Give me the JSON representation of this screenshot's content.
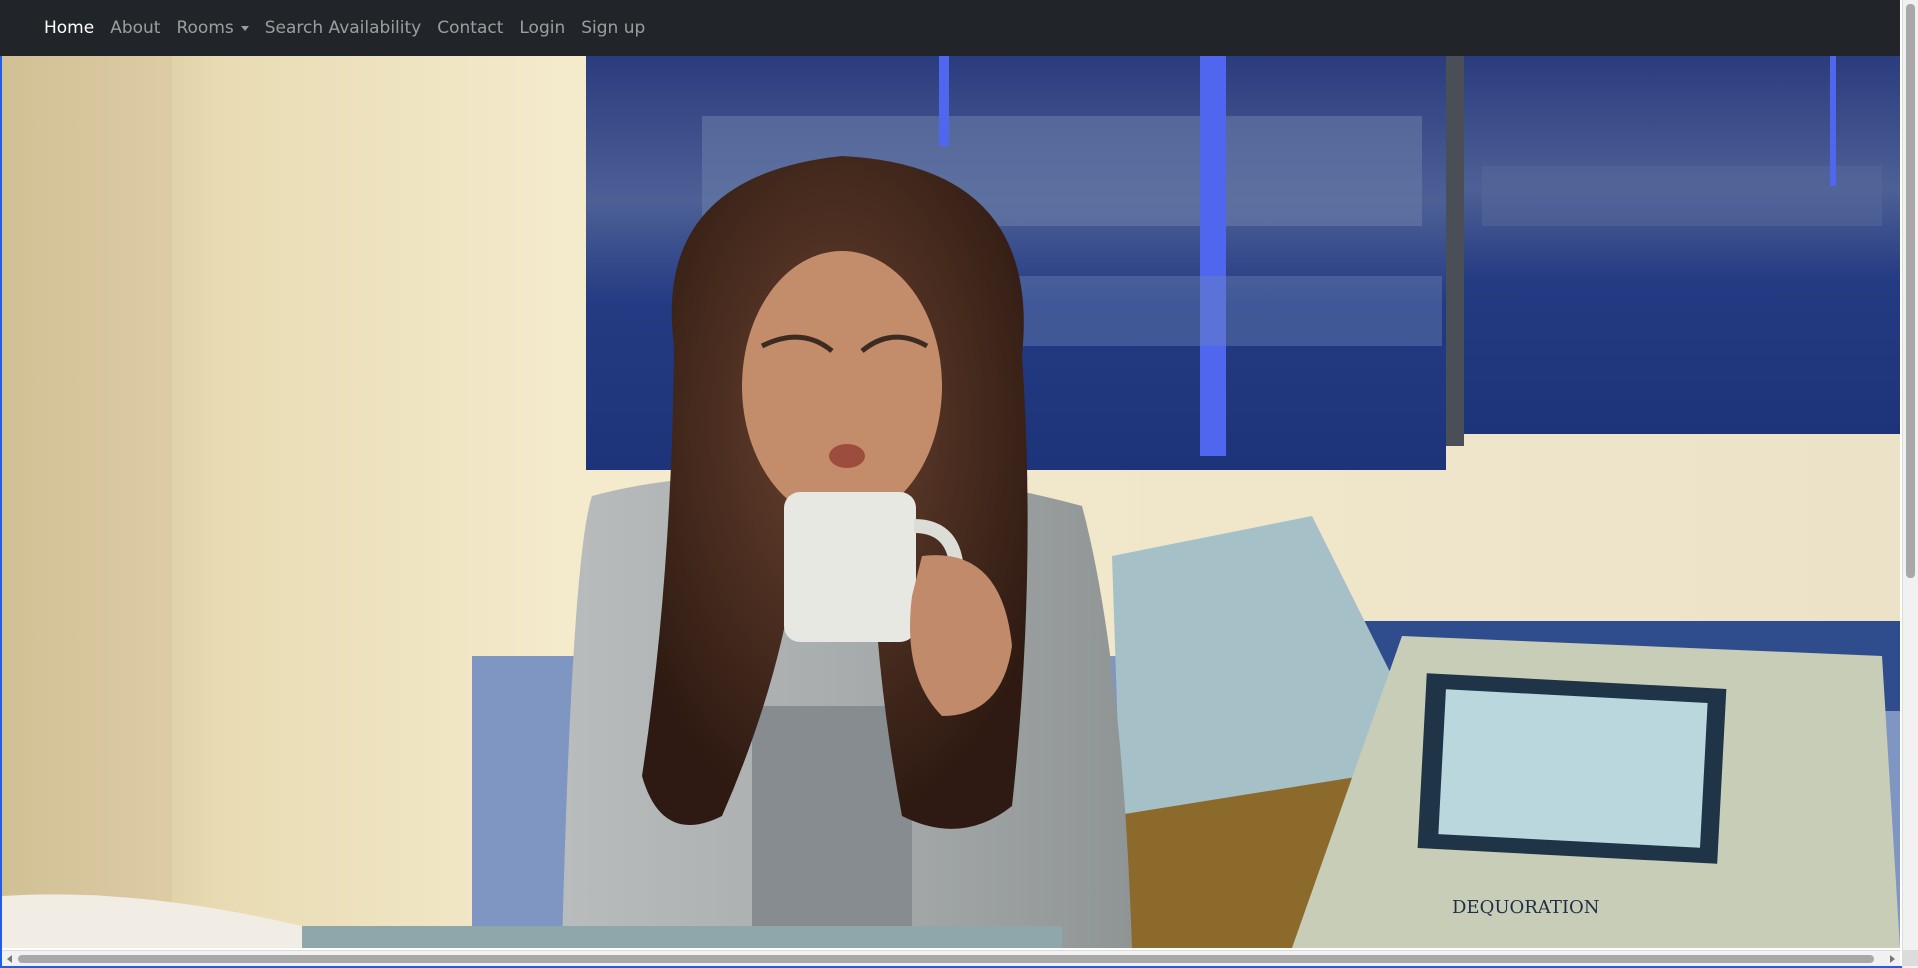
{
  "navbar": {
    "items": [
      {
        "label": "Home",
        "active": true
      },
      {
        "label": "About",
        "active": false
      },
      {
        "label": "Rooms",
        "active": false,
        "dropdown": true
      },
      {
        "label": "Search Availability",
        "active": false
      },
      {
        "label": "Contact",
        "active": false
      },
      {
        "label": "Login",
        "active": false
      },
      {
        "label": "Sign up",
        "active": false
      }
    ]
  },
  "hero": {
    "pillow_brand": "DEQUORATION"
  },
  "colors": {
    "navbar_bg": "#212529",
    "nav_active": "#ffffff",
    "nav_inactive": "#8e9195",
    "window_border": "#1f5fe8"
  }
}
